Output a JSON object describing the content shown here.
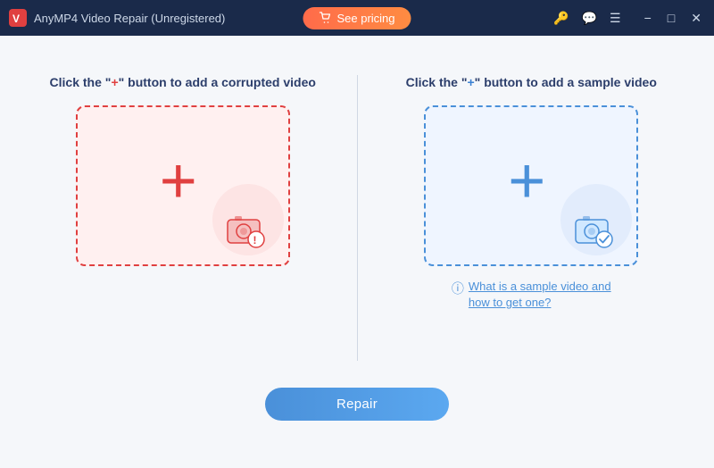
{
  "titlebar": {
    "logo_alt": "AnyMP4 logo",
    "title": "AnyMP4 Video Repair (Unregistered)",
    "pricing_btn": "See pricing",
    "icons": [
      "key-icon",
      "chat-icon",
      "menu-icon"
    ],
    "controls": [
      "minimize-icon",
      "maximize-icon",
      "close-icon"
    ]
  },
  "left_panel": {
    "instruction": "Click the \"+\" button to add a corrupted video",
    "plus_symbol": "+",
    "box_alt": "Add corrupted video"
  },
  "right_panel": {
    "instruction": "Click the \"+\" button to add a sample video",
    "plus_symbol": "+",
    "box_alt": "Add sample video",
    "help_link": "What is a sample video and\nhow to get one?"
  },
  "repair_button": {
    "label": "Repair"
  },
  "colors": {
    "red_accent": "#e04040",
    "blue_accent": "#4a90d9",
    "bg": "#f5f7fa",
    "titlebar_bg": "#1a2a4a"
  }
}
